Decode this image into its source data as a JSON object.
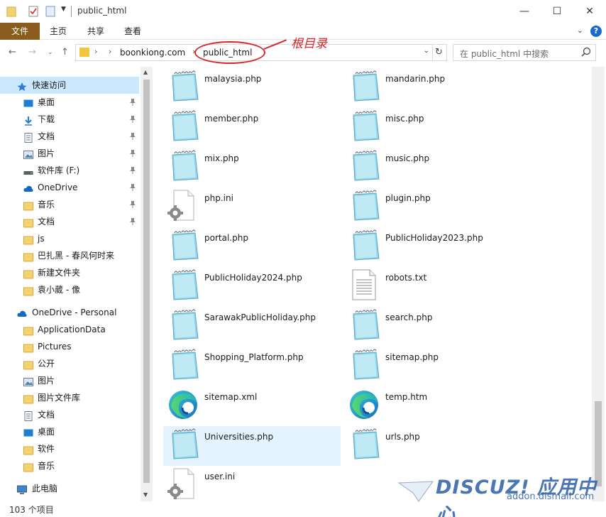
{
  "window": {
    "title": "public_html",
    "minimize": "—",
    "maximize": "☐",
    "close": "✕"
  },
  "ribbon": {
    "tabs": [
      "文件",
      "主页",
      "共享",
      "查看"
    ],
    "help": "?"
  },
  "address": {
    "crumbs": [
      "boonkiong.com",
      "public_html"
    ],
    "search_placeholder": "在 public_html 中搜索"
  },
  "annotation": {
    "text": "根目录"
  },
  "sidebar": {
    "items": [
      {
        "label": "快速访问",
        "icon": "star-icon",
        "selected": true
      },
      {
        "label": "桌面",
        "icon": "desktop-icon",
        "pinned": true
      },
      {
        "label": "下载",
        "icon": "download-icon",
        "pinned": true
      },
      {
        "label": "文档",
        "icon": "document-icon",
        "pinned": true
      },
      {
        "label": "图片",
        "icon": "picture-icon",
        "pinned": true
      },
      {
        "label": "软件库 (F:)",
        "icon": "drive-icon",
        "pinned": true
      },
      {
        "label": "OneDrive",
        "icon": "cloud-icon",
        "pinned": true
      },
      {
        "label": "音乐",
        "icon": "folder-icon",
        "pinned": true
      },
      {
        "label": "文档",
        "icon": "folder-icon",
        "pinned": true
      },
      {
        "label": "js",
        "icon": "folder-icon"
      },
      {
        "label": "巴扎黑 - 春风何时来",
        "icon": "folder-icon"
      },
      {
        "label": "新建文件夹",
        "icon": "folder-icon"
      },
      {
        "label": "袁小葳 - 像",
        "icon": "folder-icon"
      },
      {
        "label": "OneDrive - Personal",
        "icon": "cloud-icon"
      },
      {
        "label": "ApplicationData",
        "icon": "folder-icon"
      },
      {
        "label": "Pictures",
        "icon": "folder-icon"
      },
      {
        "label": "公开",
        "icon": "folder-icon"
      },
      {
        "label": "图片",
        "icon": "picture-icon"
      },
      {
        "label": "图片文件库",
        "icon": "folder-icon"
      },
      {
        "label": "文档",
        "icon": "document-icon"
      },
      {
        "label": "桌面",
        "icon": "desktop-icon"
      },
      {
        "label": "软件",
        "icon": "folder-icon"
      },
      {
        "label": "音乐",
        "icon": "folder-icon"
      },
      {
        "label": "此电脑",
        "icon": "computer-icon"
      }
    ]
  },
  "files": [
    {
      "name": "malaysia.php",
      "type": "notepad"
    },
    {
      "name": "mandarin.php",
      "type": "notepad"
    },
    {
      "name": "member.php",
      "type": "notepad"
    },
    {
      "name": "misc.php",
      "type": "notepad"
    },
    {
      "name": "mix.php",
      "type": "notepad"
    },
    {
      "name": "music.php",
      "type": "notepad"
    },
    {
      "name": "php.ini",
      "type": "config"
    },
    {
      "name": "plugin.php",
      "type": "notepad"
    },
    {
      "name": "portal.php",
      "type": "notepad"
    },
    {
      "name": "PublicHoliday2023.php",
      "type": "notepad"
    },
    {
      "name": "PublicHoliday2024.php",
      "type": "notepad"
    },
    {
      "name": "robots.txt",
      "type": "text"
    },
    {
      "name": "SarawakPublicHoliday.php",
      "type": "notepad"
    },
    {
      "name": "search.php",
      "type": "notepad"
    },
    {
      "name": "Shopping_Platform.php",
      "type": "notepad"
    },
    {
      "name": "sitemap.php",
      "type": "notepad"
    },
    {
      "name": "sitemap.xml",
      "type": "edge"
    },
    {
      "name": "temp.htm",
      "type": "edge"
    },
    {
      "name": "Universities.php",
      "type": "notepad",
      "selected": true
    },
    {
      "name": "urls.php",
      "type": "notepad"
    },
    {
      "name": "user.ini",
      "type": "config"
    }
  ],
  "status": {
    "count_text": "103 个项目"
  },
  "watermark": {
    "title": "DISCUZ! 应用中心",
    "sub": "addon.dismall.com"
  }
}
